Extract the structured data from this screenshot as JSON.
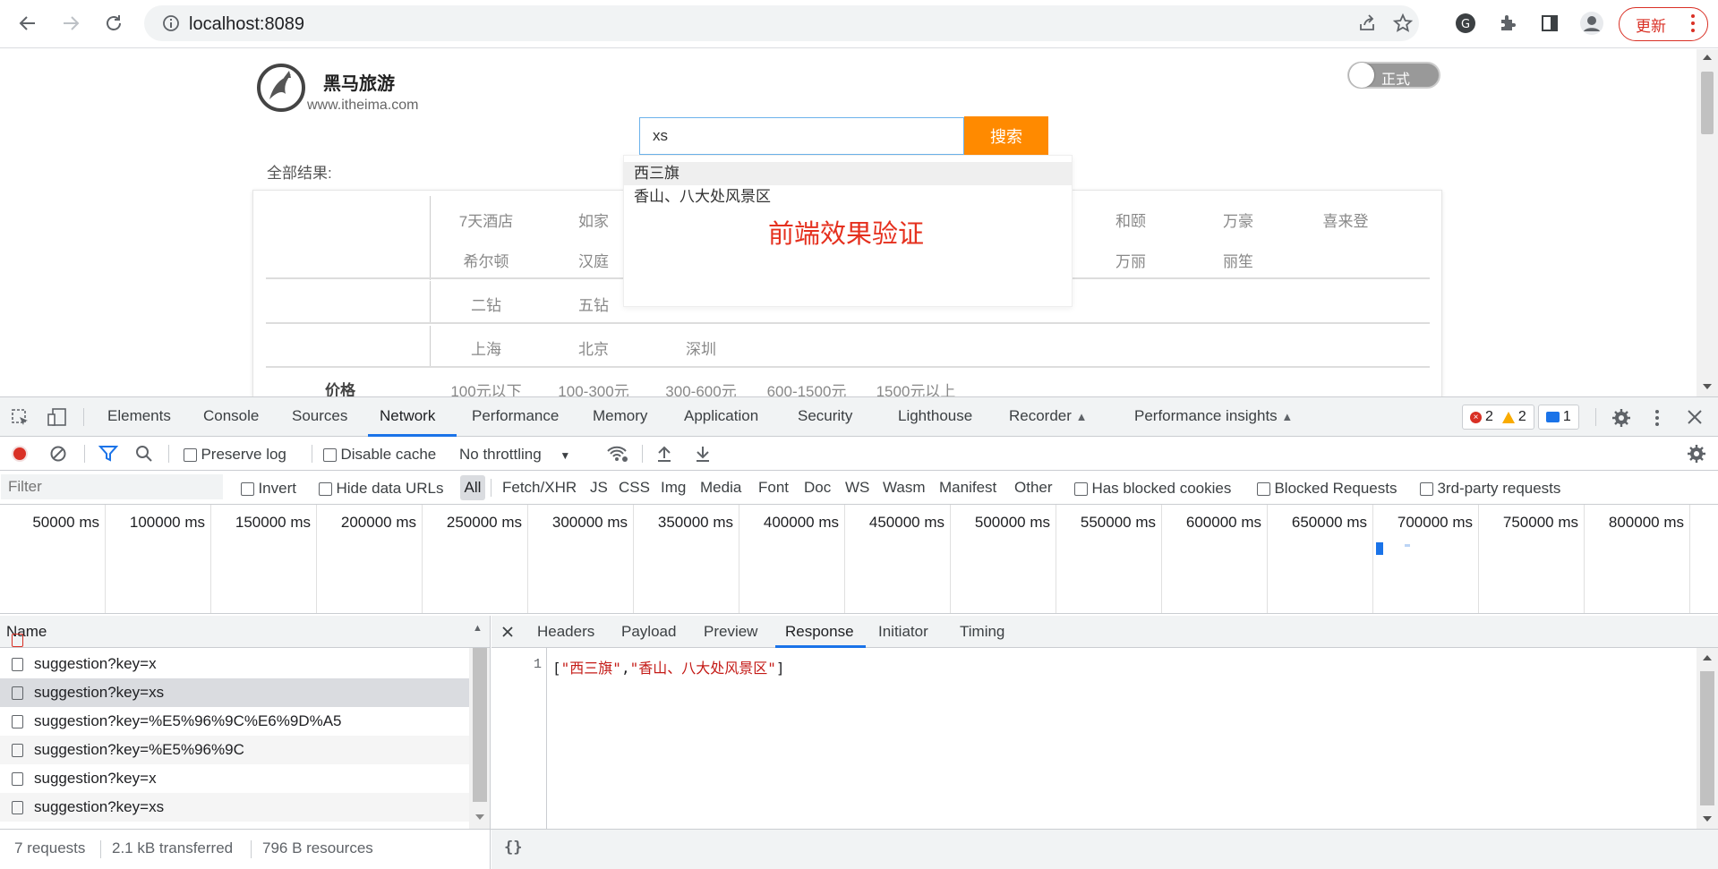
{
  "browser": {
    "url": "localhost:8089",
    "update_label": "更新"
  },
  "page": {
    "brand_name": "黑马旅游",
    "brand_url": "www.itheima.com",
    "toggle_label": "正式",
    "search": {
      "value": "xs",
      "button_label": "搜索"
    },
    "all_results_label": "全部结果:",
    "suggestions": [
      "西三旗",
      "香山、八大处风景区"
    ],
    "annotation": "前端效果验证",
    "row1": [
      "7天酒店",
      "如家",
      "和颐",
      "万豪",
      "喜来登"
    ],
    "row2": [
      "希尔顿",
      "汉庭",
      "万丽",
      "丽笙"
    ],
    "row3": [
      "二钻",
      "五钻"
    ],
    "row4": [
      "上海",
      "北京",
      "深圳"
    ],
    "price_label": "价格",
    "price_options": [
      "100元以下",
      "100-300元",
      "300-600元",
      "600-1500元",
      "1500元以上"
    ]
  },
  "devtools": {
    "tabs": [
      "Elements",
      "Console",
      "Sources",
      "Network",
      "Performance",
      "Memory",
      "Application",
      "Security",
      "Lighthouse",
      "Recorder",
      "Performance insights"
    ],
    "active_tab": "Network",
    "errors": "2",
    "warnings": "2",
    "messages": "1",
    "preserve_log": "Preserve log",
    "disable_cache": "Disable cache",
    "throttling": "No throttling",
    "filter_placeholder": "Filter",
    "invert": "Invert",
    "hide_data_urls": "Hide data URLs",
    "type_filters": [
      "All",
      "Fetch/XHR",
      "JS",
      "CSS",
      "Img",
      "Media",
      "Font",
      "Doc",
      "WS",
      "Wasm",
      "Manifest",
      "Other"
    ],
    "has_blocked_cookies": "Has blocked cookies",
    "blocked_requests": "Blocked Requests",
    "third_party": "3rd-party requests",
    "timeline_labels": [
      "50000 ms",
      "100000 ms",
      "150000 ms",
      "200000 ms",
      "250000 ms",
      "300000 ms",
      "350000 ms",
      "400000 ms",
      "450000 ms",
      "500000 ms",
      "550000 ms",
      "600000 ms",
      "650000 ms",
      "700000 ms",
      "750000 ms",
      "800000 ms"
    ],
    "name_column": "Name",
    "requests": [
      "suggestion?key=x",
      "suggestion?key=xs",
      "suggestion?key=%E5%96%9C%E6%9D%A5",
      "suggestion?key=%E5%96%9C",
      "suggestion?key=x",
      "suggestion?key=xs"
    ],
    "detail_tabs": [
      "Headers",
      "Payload",
      "Preview",
      "Response",
      "Initiator",
      "Timing"
    ],
    "active_detail_tab": "Response",
    "response_line_no": "1",
    "response_items": [
      "西三旗",
      "香山、八大处风景区"
    ],
    "status": {
      "requests": "7 requests",
      "transferred": "2.1 kB transferred",
      "resources": "796 B resources"
    },
    "format_icon": "{}"
  }
}
